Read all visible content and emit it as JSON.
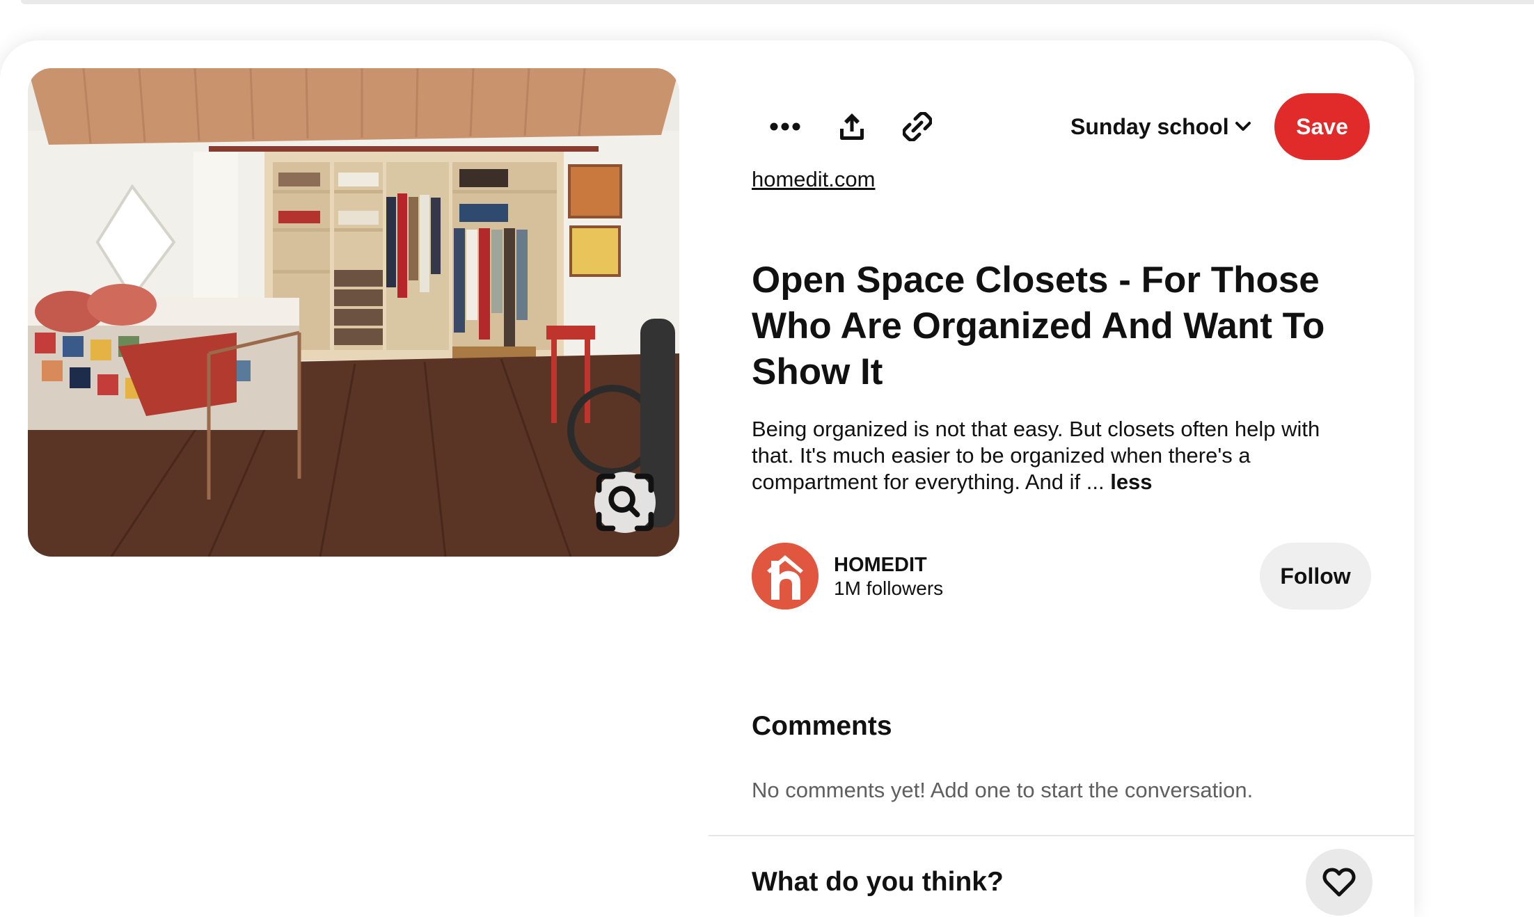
{
  "actions": {
    "more_icon": "ellipsis-icon",
    "share_icon": "share-upload-icon",
    "link_icon": "link-icon",
    "board_name": "Sunday school",
    "save_label": "Save"
  },
  "pin": {
    "source": "homedit.com",
    "title": "Open Space Closets - For Those Who Are Organized And Want To Show It",
    "description": "Being organized is not that easy. But closets often help with that. It's much easier to be organized when there's a compartment for everything. And if ...",
    "less_label": "less"
  },
  "creator": {
    "name": "HOMEDIT",
    "followers": "1M followers",
    "follow_label": "Follow"
  },
  "comments": {
    "heading": "Comments",
    "empty_text": "No comments yet! Add one to start the conversation.",
    "prompt": "What do you think?"
  },
  "colors": {
    "accent": "#e12a2a",
    "follow_bg": "#efefef",
    "avatar_brand": "#e0563f"
  }
}
